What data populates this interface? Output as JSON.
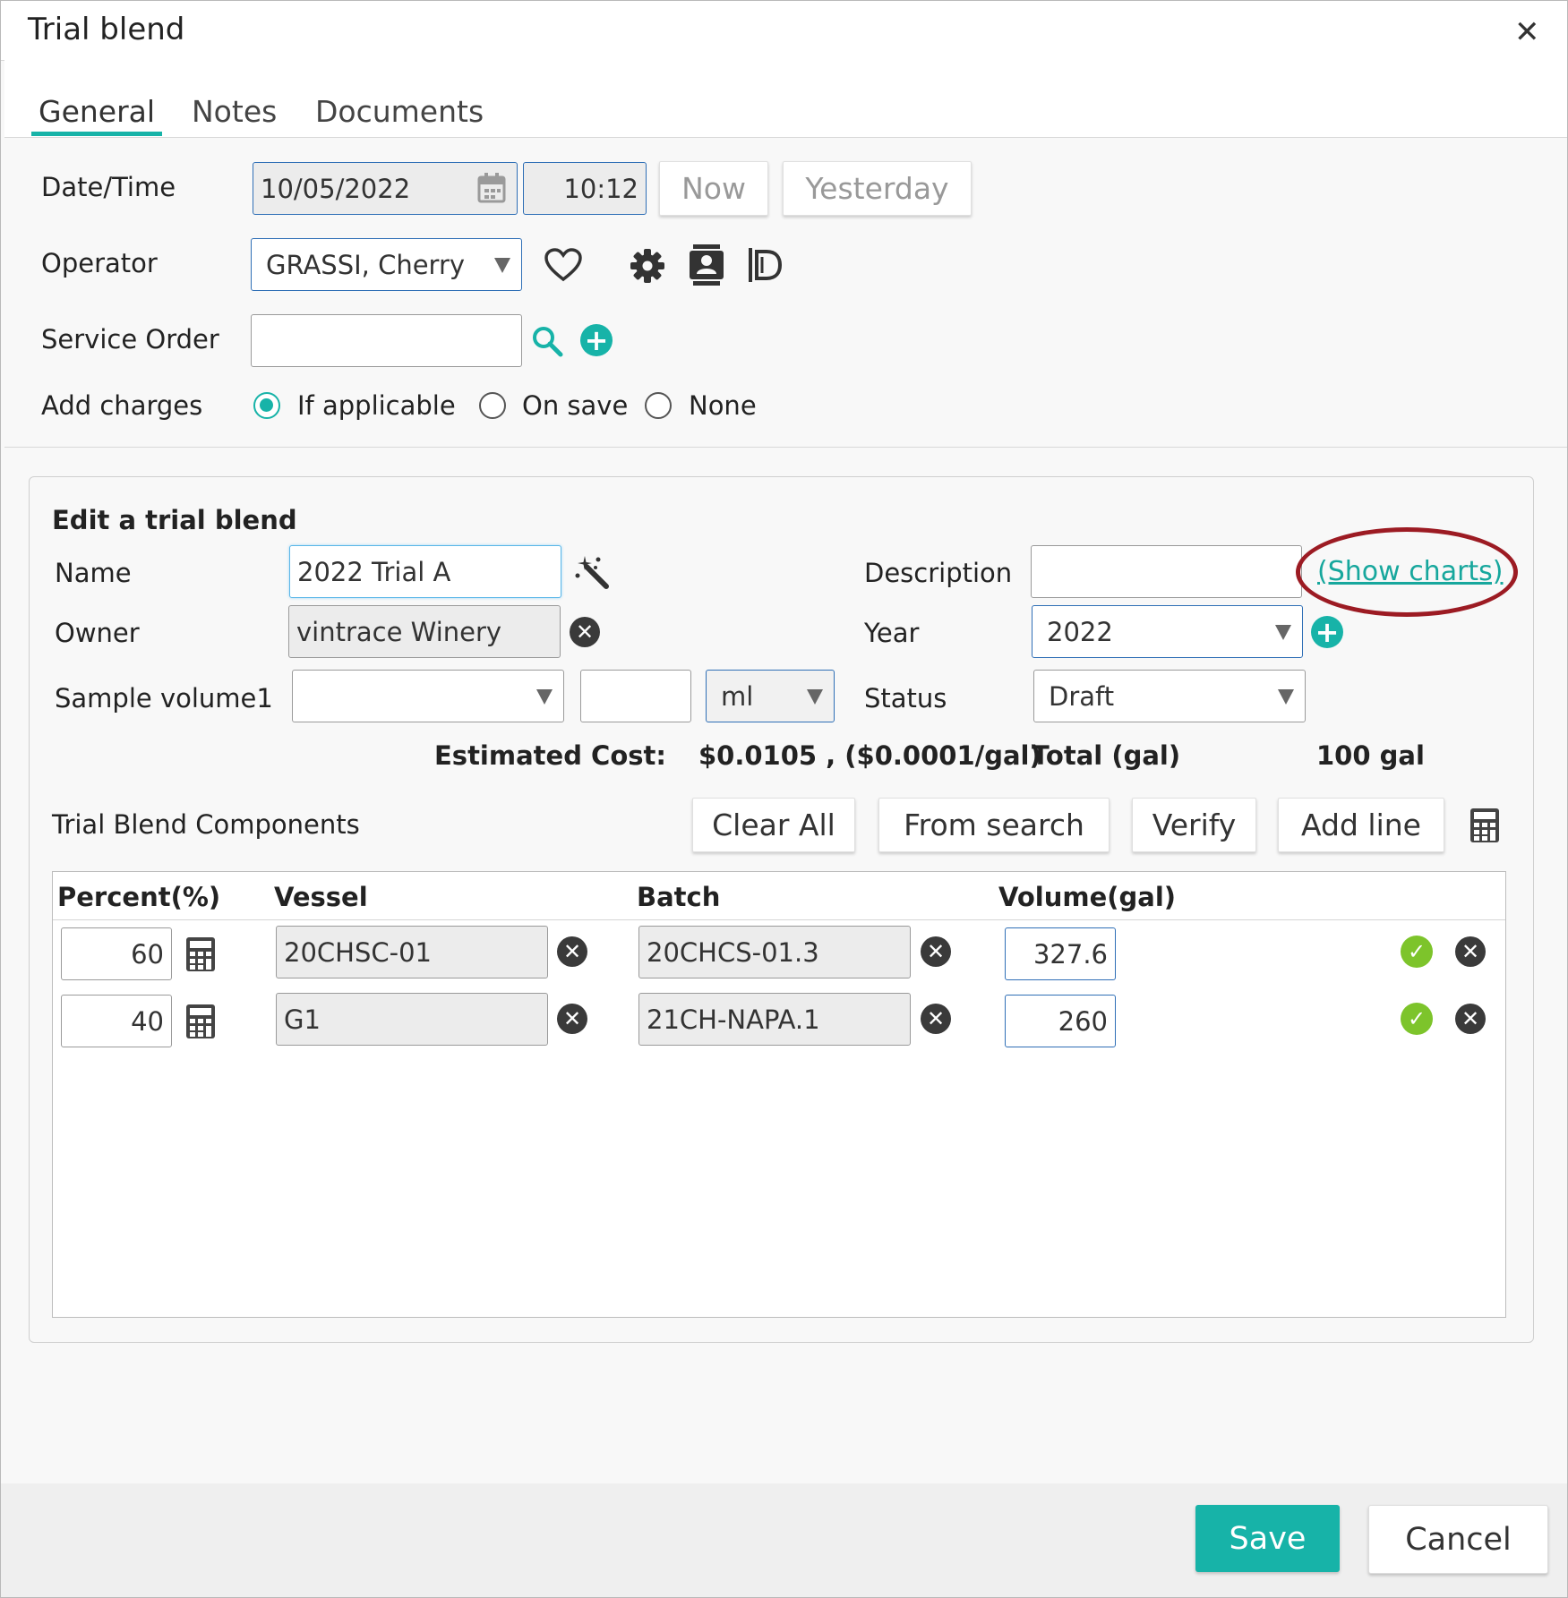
{
  "window": {
    "title": "Trial blend"
  },
  "tabs": [
    {
      "label": "General",
      "active": true
    },
    {
      "label": "Notes",
      "active": false
    },
    {
      "label": "Documents",
      "active": false
    }
  ],
  "general": {
    "datetime_label": "Date/Time",
    "date_value": "10/05/2022",
    "time_value": "10:12",
    "now_label": "Now",
    "yesterday_label": "Yesterday",
    "operator_label": "Operator",
    "operator_value": "GRASSI, Cherry",
    "service_order_label": "Service Order",
    "service_order_value": "",
    "add_charges_label": "Add charges",
    "add_charges_options": [
      {
        "label": "If applicable",
        "selected": true
      },
      {
        "label": "On save",
        "selected": false
      },
      {
        "label": "None",
        "selected": false
      }
    ]
  },
  "trial_blend": {
    "heading": "Edit a trial blend",
    "name_label": "Name",
    "name_value": "2022 Trial A",
    "owner_label": "Owner",
    "owner_value": "vintrace Winery",
    "sample_volume_label": "Sample volume1",
    "sample_volume_select": "",
    "sample_volume_amount": "",
    "sample_volume_unit": "ml",
    "description_label": "Description",
    "description_value": "",
    "show_charts_label": "(Show charts)",
    "year_label": "Year",
    "year_value": "2022",
    "status_label": "Status",
    "status_value": "Draft",
    "estimated_cost_label": "Estimated Cost:",
    "estimated_cost_value": "$0.0105 , ($0.0001/gal)",
    "total_label": "Total (gal)",
    "total_value": "100 gal"
  },
  "components": {
    "title": "Trial Blend Components",
    "clear_all_label": "Clear All",
    "from_search_label": "From search",
    "verify_label": "Verify",
    "add_line_label": "Add line",
    "columns": [
      "Percent(%)",
      "Vessel",
      "Batch",
      "Volume(gal)"
    ],
    "rows": [
      {
        "percent": "60",
        "vessel": "20CHSC-01",
        "batch": "20CHCS-01.3",
        "volume": "327.6"
      },
      {
        "percent": "40",
        "vessel": "G1",
        "batch": "21CH-NAPA.1",
        "volume": "260"
      }
    ]
  },
  "footer": {
    "save_label": "Save",
    "cancel_label": "Cancel"
  },
  "colors": {
    "accent": "#17b3a8",
    "annotation": "#9c1b23",
    "valid": "#7dc42b"
  },
  "icons": [
    "close-icon",
    "calendar-icon",
    "chevron-down-icon",
    "heart-icon",
    "gear-icon",
    "contact-card-icon",
    "document-icon",
    "search-icon",
    "plus-circle-icon",
    "magic-wand-icon",
    "clear-circle-icon",
    "calculator-icon",
    "check-circle-icon"
  ]
}
